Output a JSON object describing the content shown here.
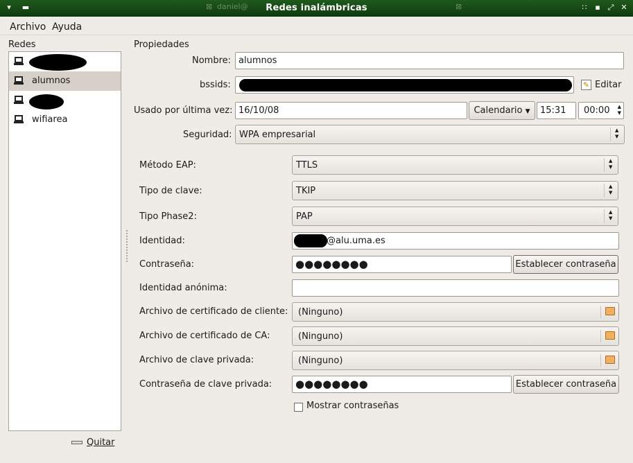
{
  "window": {
    "title": "Redes inalámbricas",
    "bg_tab": "daniel@"
  },
  "menu": {
    "archivo": "Archivo",
    "ayuda": "Ayuda"
  },
  "networks": {
    "header": "Redes",
    "items": [
      {
        "label": "",
        "redacted": true
      },
      {
        "label": "alumnos",
        "selected": true
      },
      {
        "label": "",
        "redacted": true
      },
      {
        "label": "wifiarea"
      }
    ],
    "quit_label": "Quitar"
  },
  "props": {
    "header": "Propiedades",
    "nombre_label": "Nombre:",
    "nombre_value": "alumnos",
    "bssids_label": "bssids:",
    "editar_label": "Editar",
    "usado_label": "Usado por última vez:",
    "date_value": "16/10/08",
    "calendario_label": "Calendario",
    "time_value": "15:31",
    "time2_value": "00:00",
    "seguridad_label": "Seguridad:",
    "seguridad_value": "WPA empresarial"
  },
  "eap": {
    "metodo_label": "Método EAP:",
    "metodo_value": "TTLS",
    "tipo_clave_label": "Tipo de clave:",
    "tipo_clave_value": "TKIP",
    "phase2_label": "Tipo Phase2:",
    "phase2_value": "PAP",
    "identidad_label": "Identidad:",
    "identidad_value": "@alu.uma.es",
    "contrasena_label": "Contraseña:",
    "contrasena_dots": "●●●●●●●●",
    "establecer_label": "Establecer contraseña",
    "anonima_label": "Identidad anónima:",
    "cert_cliente_label": "Archivo de certificado de cliente:",
    "cert_ca_label": "Archivo de certificado de CA:",
    "clave_privada_label": "Archivo de clave privada:",
    "ninguno": "(Ninguno)",
    "contrasena_clave_label": "Contraseña de clave privada:",
    "contrasena_clave_dots": "●●●●●●●●",
    "establecer2_label": "Establecer contraseña",
    "mostrar_label": "Mostrar contraseñas"
  }
}
